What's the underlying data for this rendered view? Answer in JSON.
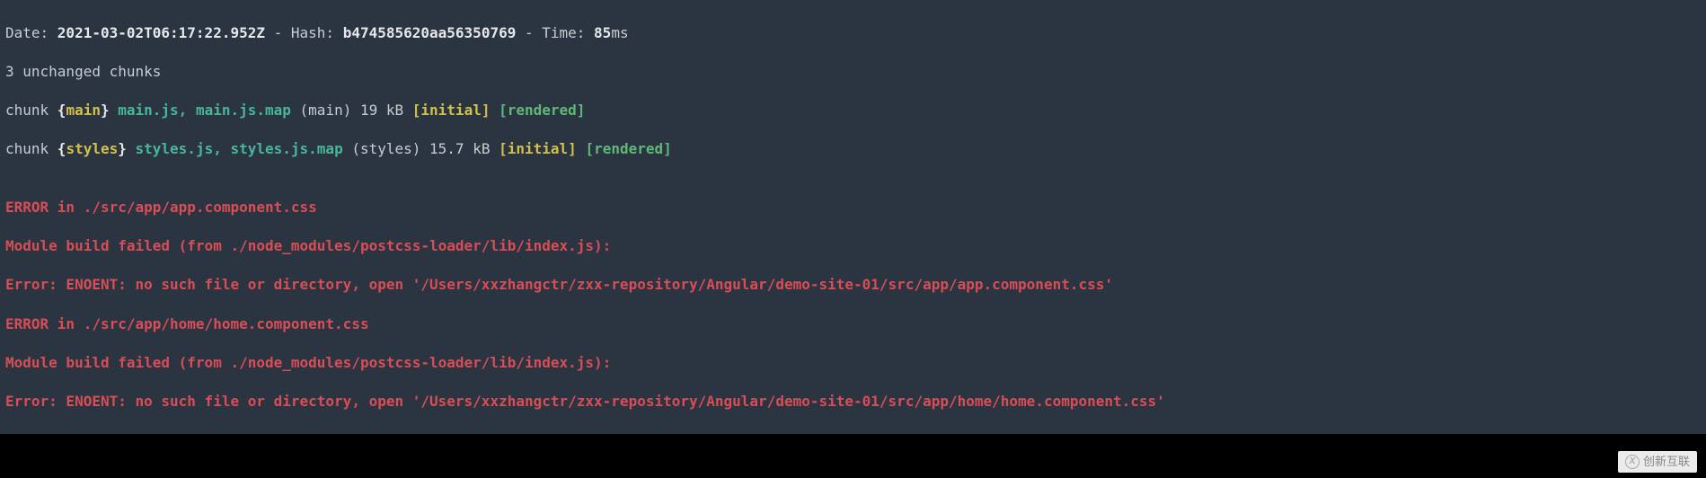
{
  "header": {
    "date_label": "Date: ",
    "date_value": "2021-03-02T06:17:22.952Z",
    "sep1": " - Hash: ",
    "hash_value": "b474585620aa56350769",
    "sep2": " - Time: ",
    "time_value": "85",
    "time_unit": "ms"
  },
  "unchanged": "3 unchanged chunks",
  "chunks": [
    {
      "prefix": "chunk ",
      "brace_open": "{",
      "name": "main",
      "brace_close": "}",
      "files": " main.js, main.js.map",
      "meta": " (main) 19 kB ",
      "initial": "[initial]",
      "space": " ",
      "rendered": "[rendered]"
    },
    {
      "prefix": "chunk ",
      "brace_open": "{",
      "name": "styles",
      "brace_close": "}",
      "files": " styles.js, styles.js.map",
      "meta": " (styles) 15.7 kB ",
      "initial": "[initial]",
      "space": " ",
      "rendered": "[rendered]"
    }
  ],
  "blank": "",
  "errors": [
    "ERROR in ./src/app/app.component.css",
    "Module build failed (from ./node_modules/postcss-loader/lib/index.js):",
    "Error: ENOENT: no such file or directory, open '/Users/xxzhangctr/zxx-repository/Angular/demo-site-01/src/app/app.component.css'",
    "ERROR in ./src/app/home/home.component.css",
    "Module build failed (from ./node_modules/postcss-loader/lib/index.js):",
    "Error: ENOENT: no such file or directory, open '/Users/xxzhangctr/zxx-repository/Angular/demo-site-01/src/app/home/home.component.css'"
  ],
  "watermark": "创新互联"
}
